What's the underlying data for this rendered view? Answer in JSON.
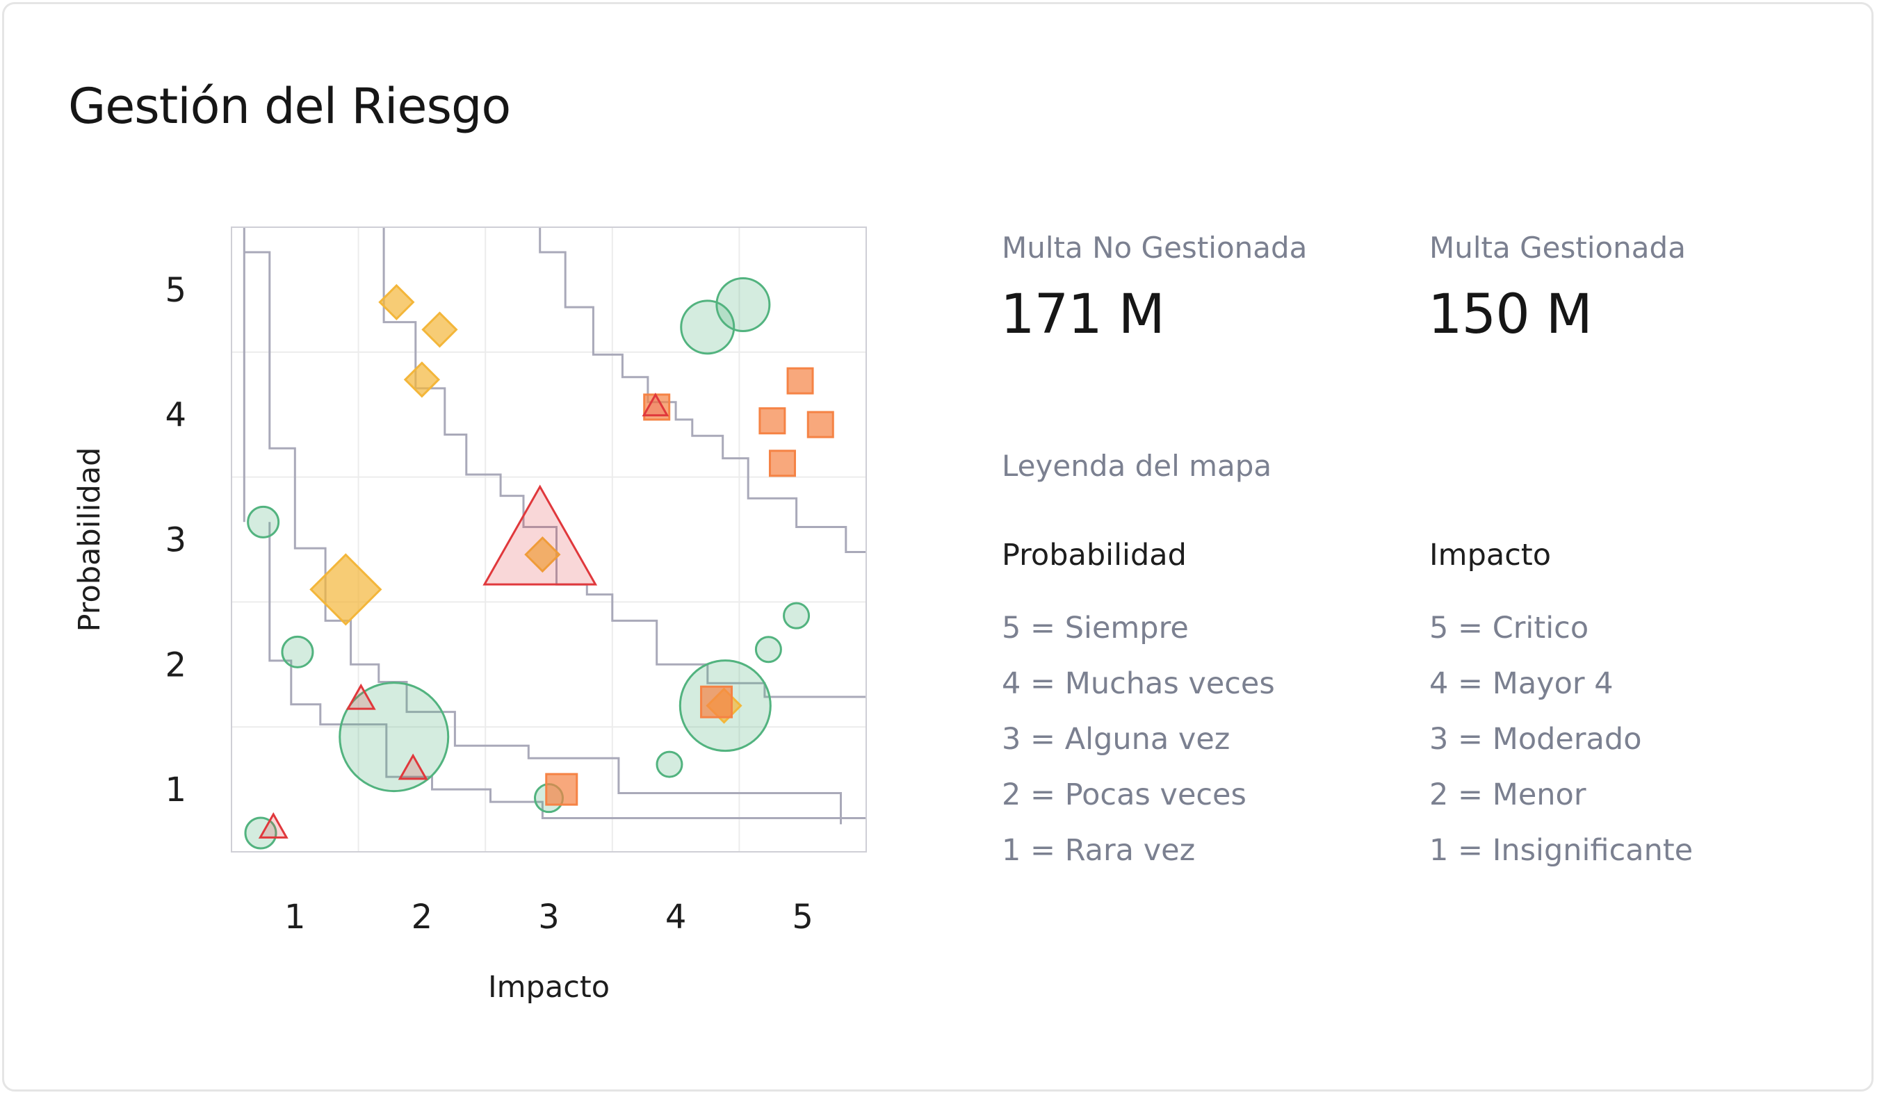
{
  "title": "Gestión del Riesgo",
  "kpis": [
    {
      "label": "Multa No Gestionada",
      "value": "171 M"
    },
    {
      "label": "Multa Gestionada",
      "value": "150 M"
    }
  ],
  "legend": {
    "title": "Leyenda del mapa",
    "probabilidad": {
      "heading": "Probabilidad",
      "items": [
        "5 = Siempre",
        "4 = Muchas veces",
        "3 = Alguna vez",
        "2 = Pocas veces",
        "1 = Rara vez"
      ]
    },
    "impacto": {
      "heading": "Impacto",
      "items": [
        "5 = Critico",
        "4 = Mayor 4",
        "3 = Moderado",
        "2 = Menor",
        "1 = Insignificante"
      ]
    }
  },
  "colors": {
    "green": "#52b37f",
    "yellow": "#f3b63a",
    "orange": "#f58345",
    "red": "#e0383c",
    "contour": "#a9a9b9",
    "grid": "#ececec"
  },
  "chart_data": {
    "type": "scatter",
    "xlabel": "Impacto",
    "ylabel": "Probabilidad",
    "xlim": [
      0.5,
      5.5
    ],
    "ylim": [
      0.5,
      5.5
    ],
    "xticks": [
      1,
      2,
      3,
      4,
      5
    ],
    "yticks": [
      1,
      2,
      3,
      4,
      5
    ],
    "grid": true,
    "series": [
      {
        "color": "green",
        "marker": "circle",
        "points": [
          {
            "x": 0.73,
            "y": 0.65,
            "size": 22
          },
          {
            "x": 0.75,
            "y": 3.14,
            "size": 22
          },
          {
            "x": 1.02,
            "y": 2.1,
            "size": 22
          },
          {
            "x": 1.78,
            "y": 1.42,
            "size": 78
          },
          {
            "x": 3.0,
            "y": 0.93,
            "size": 20
          },
          {
            "x": 3.95,
            "y": 1.2,
            "size": 18
          },
          {
            "x": 4.39,
            "y": 1.67,
            "size": 65
          },
          {
            "x": 4.73,
            "y": 2.12,
            "size": 18
          },
          {
            "x": 4.95,
            "y": 2.39,
            "size": 18
          },
          {
            "x": 4.25,
            "y": 4.7,
            "size": 38
          },
          {
            "x": 4.53,
            "y": 4.88,
            "size": 38
          }
        ]
      },
      {
        "color": "yellow",
        "marker": "diamond",
        "points": [
          {
            "x": 1.8,
            "y": 4.9,
            "size": 24
          },
          {
            "x": 2.14,
            "y": 4.68,
            "size": 24
          },
          {
            "x": 2.0,
            "y": 4.28,
            "size": 24
          },
          {
            "x": 1.4,
            "y": 2.6,
            "size": 50
          },
          {
            "x": 2.95,
            "y": 2.88,
            "size": 24
          },
          {
            "x": 4.38,
            "y": 1.67,
            "size": 24
          }
        ]
      },
      {
        "color": "orange",
        "marker": "square",
        "points": [
          {
            "x": 3.85,
            "y": 4.06,
            "size": 18
          },
          {
            "x": 4.76,
            "y": 3.95,
            "size": 18
          },
          {
            "x": 4.98,
            "y": 4.27,
            "size": 18
          },
          {
            "x": 5.14,
            "y": 3.92,
            "size": 18
          },
          {
            "x": 4.84,
            "y": 3.61,
            "size": 18
          },
          {
            "x": 4.32,
            "y": 1.7,
            "size": 22
          },
          {
            "x": 3.1,
            "y": 1.0,
            "size": 22
          }
        ]
      },
      {
        "color": "red",
        "marker": "triangle",
        "points": [
          {
            "x": 0.83,
            "y": 0.7,
            "size": 18
          },
          {
            "x": 1.52,
            "y": 1.73,
            "size": 18
          },
          {
            "x": 1.93,
            "y": 1.17,
            "size": 18
          },
          {
            "x": 2.93,
            "y": 3.0,
            "size": 76
          },
          {
            "x": 3.84,
            "y": 4.07,
            "size": 16
          }
        ]
      }
    ],
    "contours": [
      [
        [
          0.6,
          5.5
        ],
        [
          0.6,
          3.14
        ]
      ],
      [
        [
          0.6,
          5.3
        ],
        [
          0.8,
          5.3
        ],
        [
          0.8,
          3.73
        ],
        [
          1.0,
          3.73
        ],
        [
          1.0,
          2.93
        ],
        [
          1.24,
          2.93
        ],
        [
          1.24,
          2.35
        ],
        [
          1.44,
          2.35
        ],
        [
          1.44,
          2.0
        ],
        [
          1.66,
          2.0
        ],
        [
          1.66,
          1.86
        ],
        [
          1.88,
          1.86
        ],
        [
          1.88,
          1.62
        ],
        [
          2.26,
          1.62
        ],
        [
          2.26,
          1.35
        ],
        [
          2.84,
          1.35
        ],
        [
          2.84,
          1.25
        ],
        [
          3.55,
          1.25
        ],
        [
          3.55,
          0.97
        ],
        [
          5.3,
          0.97
        ],
        [
          5.3,
          0.72
        ]
      ],
      [
        [
          0.8,
          3.14
        ],
        [
          0.8,
          2.03
        ],
        [
          0.97,
          2.03
        ],
        [
          0.97,
          1.68
        ],
        [
          1.2,
          1.68
        ],
        [
          1.2,
          1.52
        ],
        [
          1.72,
          1.52
        ],
        [
          1.72,
          1.1
        ],
        [
          2.08,
          1.1
        ],
        [
          2.08,
          1.0
        ],
        [
          2.54,
          1.0
        ],
        [
          2.54,
          0.9
        ],
        [
          2.95,
          0.9
        ],
        [
          2.95,
          0.77
        ],
        [
          5.5,
          0.77
        ]
      ],
      [
        [
          1.7,
          5.5
        ],
        [
          1.7,
          4.74
        ],
        [
          1.95,
          4.74
        ],
        [
          1.95,
          4.21
        ],
        [
          2.18,
          4.21
        ],
        [
          2.18,
          3.84
        ],
        [
          2.35,
          3.84
        ],
        [
          2.35,
          3.52
        ],
        [
          2.62,
          3.52
        ],
        [
          2.62,
          3.35
        ],
        [
          2.8,
          3.35
        ],
        [
          2.8,
          3.1
        ],
        [
          3.06,
          3.1
        ],
        [
          3.06,
          2.64
        ],
        [
          3.3,
          2.64
        ],
        [
          3.3,
          2.56
        ],
        [
          3.5,
          2.56
        ],
        [
          3.5,
          2.35
        ],
        [
          3.85,
          2.35
        ],
        [
          3.85,
          2.0
        ],
        [
          4.25,
          2.0
        ],
        [
          4.25,
          1.85
        ],
        [
          4.7,
          1.85
        ],
        [
          4.7,
          1.74
        ],
        [
          5.5,
          1.74
        ]
      ],
      [
        [
          2.93,
          5.5
        ],
        [
          2.93,
          5.3
        ],
        [
          3.13,
          5.3
        ],
        [
          3.13,
          4.86
        ],
        [
          3.35,
          4.86
        ],
        [
          3.35,
          4.48
        ],
        [
          3.58,
          4.48
        ],
        [
          3.58,
          4.3
        ],
        [
          3.78,
          4.3
        ],
        [
          3.78,
          4.1
        ],
        [
          4.0,
          4.1
        ],
        [
          4.0,
          3.96
        ],
        [
          4.13,
          3.96
        ],
        [
          4.13,
          3.83
        ],
        [
          4.37,
          3.83
        ],
        [
          4.37,
          3.65
        ],
        [
          4.57,
          3.65
        ],
        [
          4.57,
          3.33
        ],
        [
          4.95,
          3.33
        ],
        [
          4.95,
          3.1
        ],
        [
          5.34,
          3.1
        ],
        [
          5.34,
          2.9
        ],
        [
          5.5,
          2.9
        ]
      ]
    ]
  }
}
